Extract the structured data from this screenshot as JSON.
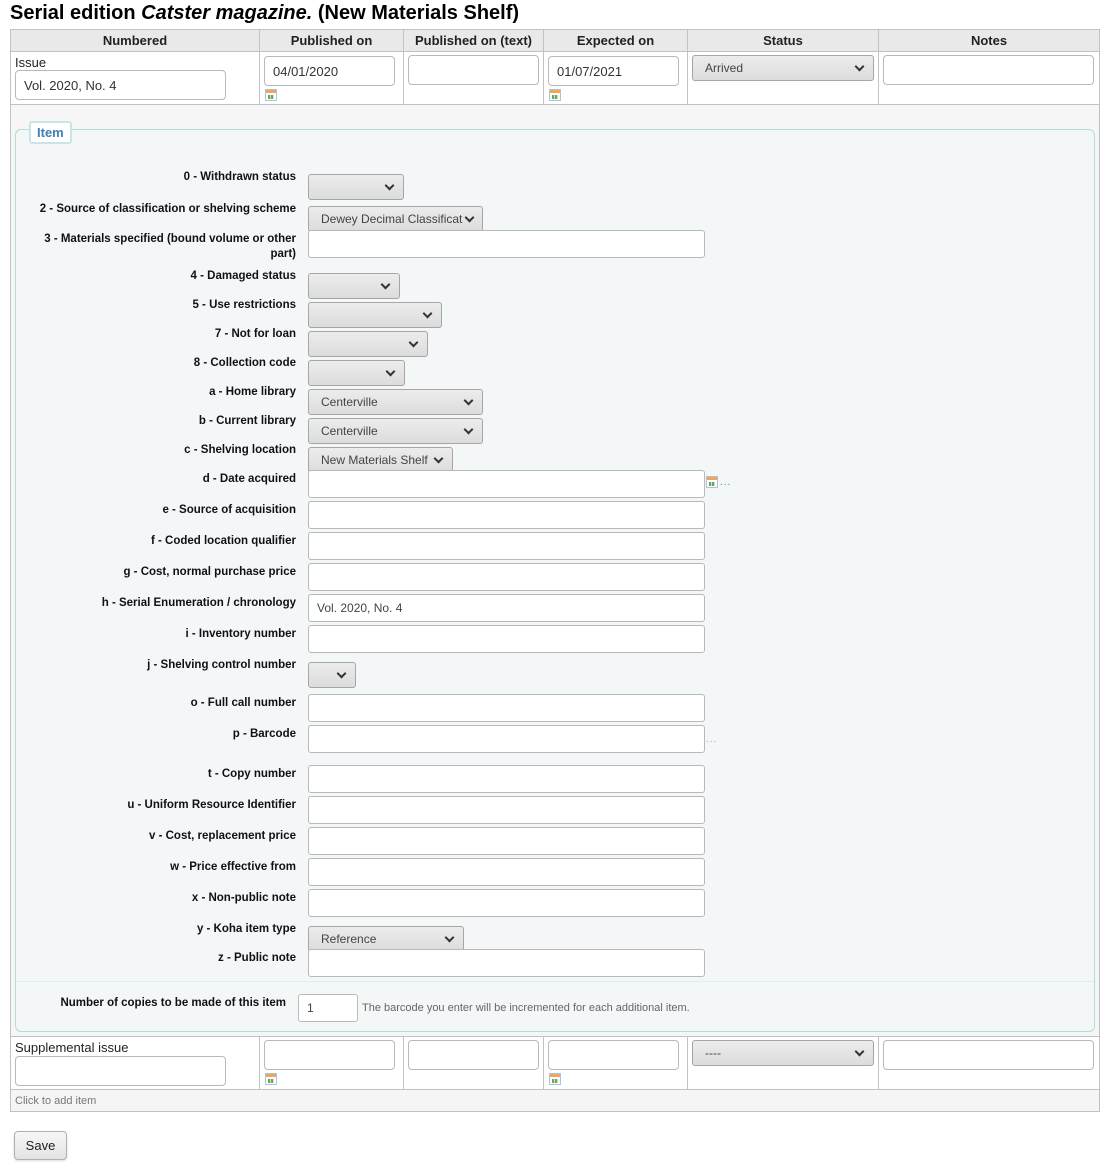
{
  "page": {
    "title_prefix": "Serial edition ",
    "title_italic": "Catster magazine.",
    "title_suffix": " (New Materials Shelf)"
  },
  "table": {
    "headers": [
      "Numbered",
      "Published on",
      "Published on (text)",
      "Expected on",
      "Status",
      "Notes"
    ],
    "issue_row": {
      "label": "Issue",
      "numbered_value": "Vol. 2020, No. 4",
      "published_on": "04/01/2020",
      "published_on_text": "",
      "expected_on": "01/07/2021",
      "status": "Arrived",
      "notes": ""
    },
    "supplemental_row": {
      "label": "Supplemental issue",
      "numbered_value": "",
      "published_on": "",
      "published_on_text": "",
      "expected_on": "",
      "status": "----",
      "notes": ""
    },
    "add_item_text": "Click to add item"
  },
  "item": {
    "legend": "Item",
    "fields": [
      {
        "label": "0 - Withdrawn status",
        "type": "select",
        "value": ""
      },
      {
        "label": "2 - Source of classification or shelving scheme",
        "type": "select",
        "value": "Dewey Decimal Classificat"
      },
      {
        "label": "3 - Materials specified (bound volume or other part)",
        "type": "text",
        "value": ""
      },
      {
        "label": "4 - Damaged status",
        "type": "select",
        "value": ""
      },
      {
        "label": "5 - Use restrictions",
        "type": "select",
        "value": ""
      },
      {
        "label": "7 - Not for loan",
        "type": "select",
        "value": ""
      },
      {
        "label": "8 - Collection code",
        "type": "select",
        "value": ""
      },
      {
        "label": "a - Home library",
        "type": "select",
        "value": "Centerville"
      },
      {
        "label": "b - Current library",
        "type": "select",
        "value": "Centerville"
      },
      {
        "label": "c - Shelving location",
        "type": "select",
        "value": "New Materials Shelf"
      },
      {
        "label": "d - Date acquired",
        "type": "text",
        "value": ""
      },
      {
        "label": "e - Source of acquisition",
        "type": "text",
        "value": ""
      },
      {
        "label": "f - Coded location qualifier",
        "type": "text",
        "value": ""
      },
      {
        "label": "g - Cost, normal purchase price",
        "type": "text",
        "value": ""
      },
      {
        "label": "h - Serial Enumeration / chronology",
        "type": "text",
        "value": "Vol. 2020, No. 4"
      },
      {
        "label": "i - Inventory number",
        "type": "text",
        "value": ""
      },
      {
        "label": "j - Shelving control number",
        "type": "select",
        "value": ""
      },
      {
        "label": "o - Full call number",
        "type": "text",
        "value": ""
      },
      {
        "label": "p - Barcode",
        "type": "text",
        "value": ""
      },
      {
        "label": "t - Copy number",
        "type": "text",
        "value": ""
      },
      {
        "label": "u - Uniform Resource Identifier",
        "type": "text",
        "value": ""
      },
      {
        "label": "v - Cost, replacement price",
        "type": "text",
        "value": ""
      },
      {
        "label": "w - Price effective from",
        "type": "text",
        "value": ""
      },
      {
        "label": "x - Non-public note",
        "type": "text",
        "value": ""
      },
      {
        "label": "y - Koha item type",
        "type": "select",
        "value": "Reference"
      },
      {
        "label": "z - Public note",
        "type": "text",
        "value": ""
      }
    ],
    "plugin_link": "...",
    "copies_label": "Number of copies to be made of this item",
    "copies_value": "1",
    "copies_hint": "The barcode you enter will be incremented for each additional item."
  },
  "actions": {
    "save_label": "Save"
  },
  "icons": {
    "calendar": "calendar-icon",
    "dropdown": "chevron-down-icon"
  }
}
